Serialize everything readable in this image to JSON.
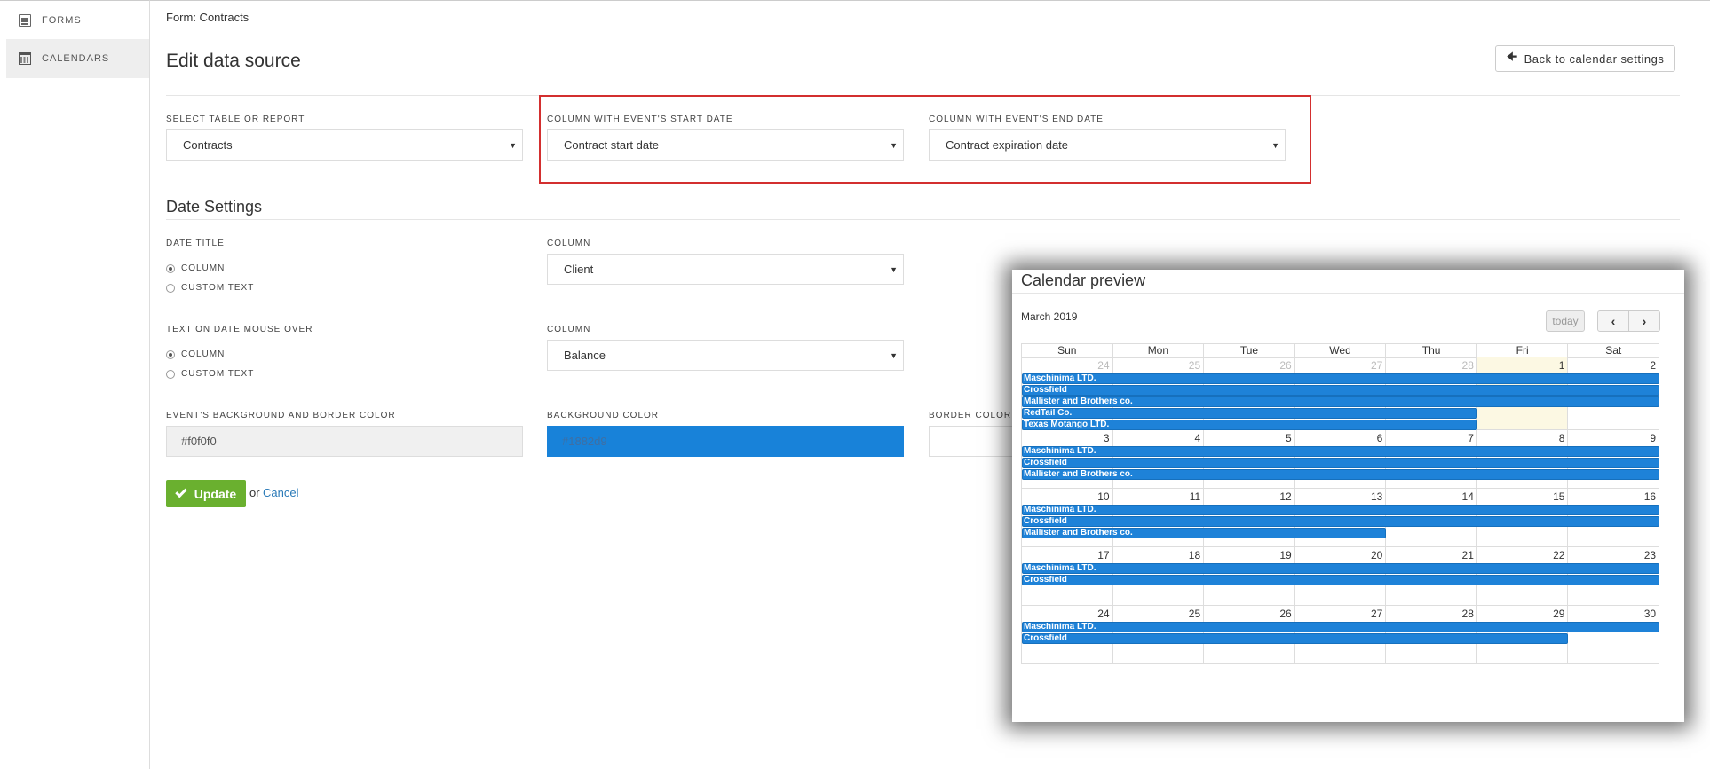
{
  "sidebar": {
    "items": [
      {
        "label": "FORMS",
        "icon": "form-icon"
      },
      {
        "label": "CALENDARS",
        "icon": "calendar-icon"
      }
    ]
  },
  "breadcrumb": "Form: Contracts",
  "page_title": "Edit data source",
  "back_button": "Back to calendar settings",
  "fields": {
    "table": {
      "label": "SELECT TABLE OR REPORT",
      "value": "Contracts"
    },
    "start": {
      "label": "COLUMN WITH EVENT'S START DATE",
      "value": "Contract start date"
    },
    "end": {
      "label": "COLUMN WITH EVENT'S END DATE",
      "value": "Contract expiration date"
    }
  },
  "date_settings": {
    "title": "Date Settings",
    "date_title": {
      "label": "DATE TITLE",
      "options": [
        "COLUMN",
        "CUSTOM TEXT"
      ],
      "selected": "COLUMN",
      "column_label": "COLUMN",
      "column_value": "Client"
    },
    "mouse_over": {
      "label": "TEXT ON DATE MOUSE OVER",
      "options": [
        "COLUMN",
        "CUSTOM TEXT"
      ],
      "selected": "COLUMN",
      "column_label": "COLUMN",
      "column_value": "Balance"
    },
    "colors": {
      "event_label": "EVENT'S BACKGROUND AND BORDER COLOR",
      "event_value": "#f0f0f0",
      "bg_label": "BACKGROUND COLOR",
      "bg_value": "#1882d9",
      "border_label": "BORDER COLOR",
      "border_value": ""
    }
  },
  "actions": {
    "update": "Update",
    "or": "or",
    "cancel": "Cancel"
  },
  "preview": {
    "title": "Calendar preview",
    "month": "March 2019",
    "today": "today",
    "prev": "<",
    "next": ">",
    "day_headers": [
      "Sun",
      "Mon",
      "Tue",
      "Wed",
      "Thu",
      "Fri",
      "Sat"
    ],
    "weeks": [
      {
        "days": [
          "24",
          "25",
          "26",
          "27",
          "28",
          "1",
          "2"
        ],
        "other": [
          true,
          true,
          true,
          true,
          true,
          false,
          false
        ],
        "today_index": 5,
        "events": [
          {
            "title": "Maschinima LTD.",
            "start": 0,
            "span": 7
          },
          {
            "title": "Crossfield",
            "start": 0,
            "span": 7
          },
          {
            "title": "Mallister and Brothers co.",
            "start": 0,
            "span": 7
          },
          {
            "title": "RedTail Co.",
            "start": 0,
            "span": 5
          },
          {
            "title": "Texas Motango LTD.",
            "start": 0,
            "span": 5
          }
        ]
      },
      {
        "days": [
          "3",
          "4",
          "5",
          "6",
          "7",
          "8",
          "9"
        ],
        "other": [
          false,
          false,
          false,
          false,
          false,
          false,
          false
        ],
        "today_index": -1,
        "events": [
          {
            "title": "Maschinima LTD.",
            "start": 0,
            "span": 7
          },
          {
            "title": "Crossfield",
            "start": 0,
            "span": 7
          },
          {
            "title": "Mallister and Brothers co.",
            "start": 0,
            "span": 7
          }
        ]
      },
      {
        "days": [
          "10",
          "11",
          "12",
          "13",
          "14",
          "15",
          "16"
        ],
        "other": [
          false,
          false,
          false,
          false,
          false,
          false,
          false
        ],
        "today_index": -1,
        "events": [
          {
            "title": "Maschinima LTD.",
            "start": 0,
            "span": 7
          },
          {
            "title": "Crossfield",
            "start": 0,
            "span": 7
          },
          {
            "title": "Mallister and Brothers co.",
            "start": 0,
            "span": 4
          }
        ]
      },
      {
        "days": [
          "17",
          "18",
          "19",
          "20",
          "21",
          "22",
          "23"
        ],
        "other": [
          false,
          false,
          false,
          false,
          false,
          false,
          false
        ],
        "today_index": -1,
        "events": [
          {
            "title": "Maschinima LTD.",
            "start": 0,
            "span": 7
          },
          {
            "title": "Crossfield",
            "start": 0,
            "span": 7
          }
        ]
      },
      {
        "days": [
          "24",
          "25",
          "26",
          "27",
          "28",
          "29",
          "30"
        ],
        "other": [
          false,
          false,
          false,
          false,
          false,
          false,
          false
        ],
        "today_index": -1,
        "events": [
          {
            "title": "Maschinima LTD.",
            "start": 0,
            "span": 7
          },
          {
            "title": "Crossfield",
            "start": 0,
            "span": 6
          }
        ]
      }
    ]
  },
  "colors": {
    "accent_blue": "#1e82d8",
    "update_green": "#6ab02f",
    "highlight_red": "#d32f2f",
    "link_blue": "#2a7ab8"
  }
}
